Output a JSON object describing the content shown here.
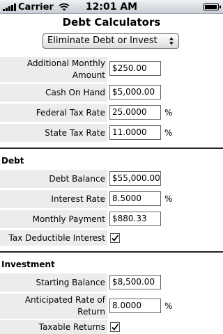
{
  "status_bar": {
    "carrier": "Carrier",
    "time": "12:01 AM",
    "battery_level": 0.95
  },
  "header": {
    "title": "Debt Calculators",
    "mode_select": "Eliminate Debt or Invest"
  },
  "general": {
    "additional_monthly_label": "Additional Monthly Amount",
    "additional_monthly_value": "$250.00",
    "cash_on_hand_label": "Cash On Hand",
    "cash_on_hand_value": "$5,000.00",
    "federal_tax_label": "Federal Tax Rate",
    "federal_tax_value": "25.0000",
    "federal_tax_unit": "%",
    "state_tax_label": "State Tax Rate",
    "state_tax_value": "11.0000",
    "state_tax_unit": "%"
  },
  "debt": {
    "section_title": "Debt",
    "balance_label": "Debt Balance",
    "balance_value": "$55,000.00",
    "interest_rate_label": "Interest Rate",
    "interest_rate_value": "8.5000",
    "interest_rate_unit": "%",
    "monthly_payment_label": "Monthly Payment",
    "monthly_payment_value": "$880.33",
    "tax_deductible_label": "Tax Deductible Interest",
    "tax_deductible_checked": true
  },
  "investment": {
    "section_title": "Investment",
    "starting_balance_label": "Starting Balance",
    "starting_balance_value": "$8,500.00",
    "anticipated_rate_label": "Anticipated Rate of Return",
    "anticipated_rate_value": "8.0000",
    "anticipated_rate_unit": "%",
    "taxable_returns_label": "Taxable Returns",
    "taxable_returns_checked": true
  }
}
